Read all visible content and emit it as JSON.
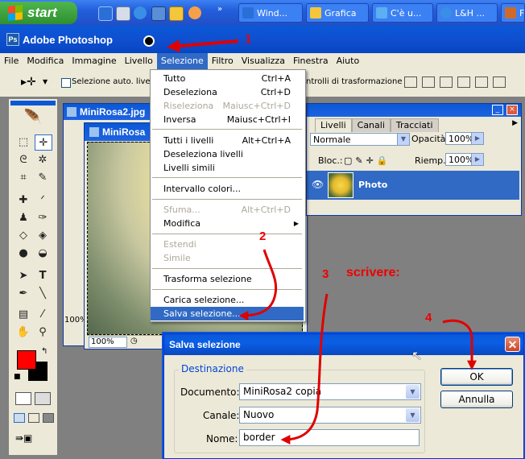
{
  "taskbar": {
    "start_label": "start",
    "tasks": [
      "Wind...",
      "Grafica",
      "C'è u...",
      "L&H ...",
      "F"
    ]
  },
  "app": {
    "title": "Adobe Photoshop"
  },
  "menubar": {
    "items": [
      "File",
      "Modifica",
      "Immagine",
      "Livello",
      "Selezione",
      "Filtro",
      "Visualizza",
      "Finestra",
      "Aiuto"
    ]
  },
  "options": {
    "auto_select_label": "Selezione auto. livello",
    "transform_label": "ntrolli di trasformazione"
  },
  "documents": {
    "doc1_title": "MiniRosa2.jpg",
    "doc2_title": "MiniRosa",
    "doc1_zoom": "100%",
    "doc2_zoom": "100%"
  },
  "layers_panel": {
    "tabs": [
      "Livelli",
      "Canali",
      "Tracciati"
    ],
    "blend_mode": "Normale",
    "opacity_label": "Opacità:",
    "opacity_value": "100%",
    "lock_label": "Bloc.:",
    "fill_label": "Riemp.:",
    "fill_value": "100%",
    "layer_name": "Photo"
  },
  "selection_menu": {
    "items": [
      {
        "label": "Tutto",
        "shortcut": "Ctrl+A",
        "disabled": false
      },
      {
        "label": "Deseleziona",
        "shortcut": "Ctrl+D",
        "disabled": false
      },
      {
        "label": "Riseleziona",
        "shortcut": "Maiusc+Ctrl+D",
        "disabled": true
      },
      {
        "label": "Inversa",
        "shortcut": "Maiusc+Ctrl+I",
        "disabled": false
      },
      {
        "label": "Tutti i livelli",
        "shortcut": "Alt+Ctrl+A",
        "disabled": false
      },
      {
        "label": "Deseleziona livelli",
        "shortcut": "",
        "disabled": false
      },
      {
        "label": "Livelli simili",
        "shortcut": "",
        "disabled": false
      },
      {
        "label": "Intervallo colori...",
        "shortcut": "",
        "disabled": false
      },
      {
        "label": "Sfuma...",
        "shortcut": "Alt+Ctrl+D",
        "disabled": true
      },
      {
        "label": "Modifica",
        "shortcut": "",
        "disabled": false
      },
      {
        "label": "Estendi",
        "shortcut": "",
        "disabled": true
      },
      {
        "label": "Simile",
        "shortcut": "",
        "disabled": true
      },
      {
        "label": "Trasforma selezione",
        "shortcut": "",
        "disabled": false
      },
      {
        "label": "Carica selezione...",
        "shortcut": "",
        "disabled": false
      },
      {
        "label": "Salva selezione...",
        "shortcut": "",
        "disabled": false
      }
    ]
  },
  "dialog": {
    "title": "Salva selezione",
    "group_label": "Destinazione",
    "document_label": "Documento:",
    "document_value": "MiniRosa2 copia",
    "channel_label": "Canale:",
    "channel_value": "Nuovo",
    "name_label": "Nome:",
    "name_value": "border",
    "ok_label": "OK",
    "cancel_label": "Annulla"
  },
  "annotations": {
    "step1": "1",
    "step2": "2",
    "step3": "3",
    "step4": "4",
    "write_label": "scrivere:",
    "color": "#e00000"
  },
  "colors": {
    "xp_blue": "#0a58d6",
    "highlight": "#316ac5",
    "foreground_color": "#ff0000",
    "background_color": "#000000"
  }
}
